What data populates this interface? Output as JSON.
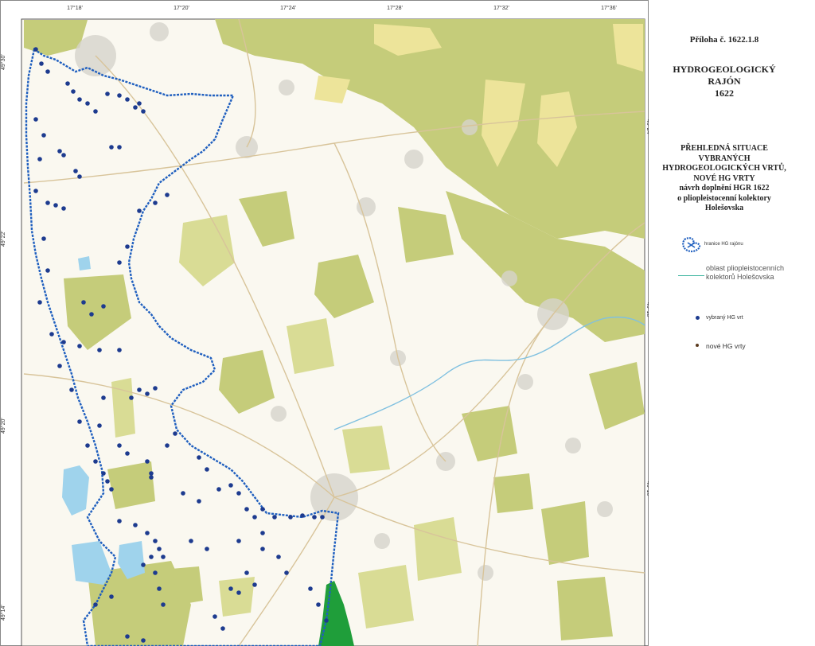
{
  "map": {
    "coords_top": [
      "17°18'",
      "17°20'",
      "17°24'",
      "17°28'",
      "17°32'",
      "17°36'"
    ],
    "coords_left": [
      "49°30'",
      "49°22'",
      "49°20'",
      "49°14'"
    ],
    "coords_right": [
      "49°24'",
      "49°18'",
      "49°16'"
    ],
    "colors": {
      "forest": "#c5cc7a",
      "forest_light": "#d9dc95",
      "sand": "#ede49a",
      "water": "#9fd3ec",
      "boundary": "#1f5fbf",
      "well": "#1d3b8f",
      "new_well": "#5b3a1e",
      "green_area": "#1f9e3a"
    }
  },
  "legend": {
    "attachment": "Příloha č. 1622.1.8",
    "title_lines": [
      "HYDROGEOLOGICKÝ",
      "RAJÓN",
      "1622"
    ],
    "subtitle_lines": [
      "PŘEHLEDNÁ SITUACE",
      "VYBRANÝCH",
      "HYDROGEOLOGICKÝCH VRTŮ,",
      "NOVÉ HG VRTY",
      "návrh doplnění HGR 1622",
      "o pliopleistocenní kolektory",
      "Holešovska"
    ],
    "items": [
      {
        "label": "hranice HG rajónu"
      },
      {
        "label_lines": [
          "oblast pliopleistocenních",
          "kolektorů Holešovska"
        ]
      },
      {
        "label": "vybraný HG vrt"
      },
      {
        "label": "nové HG vrty"
      }
    ]
  }
}
